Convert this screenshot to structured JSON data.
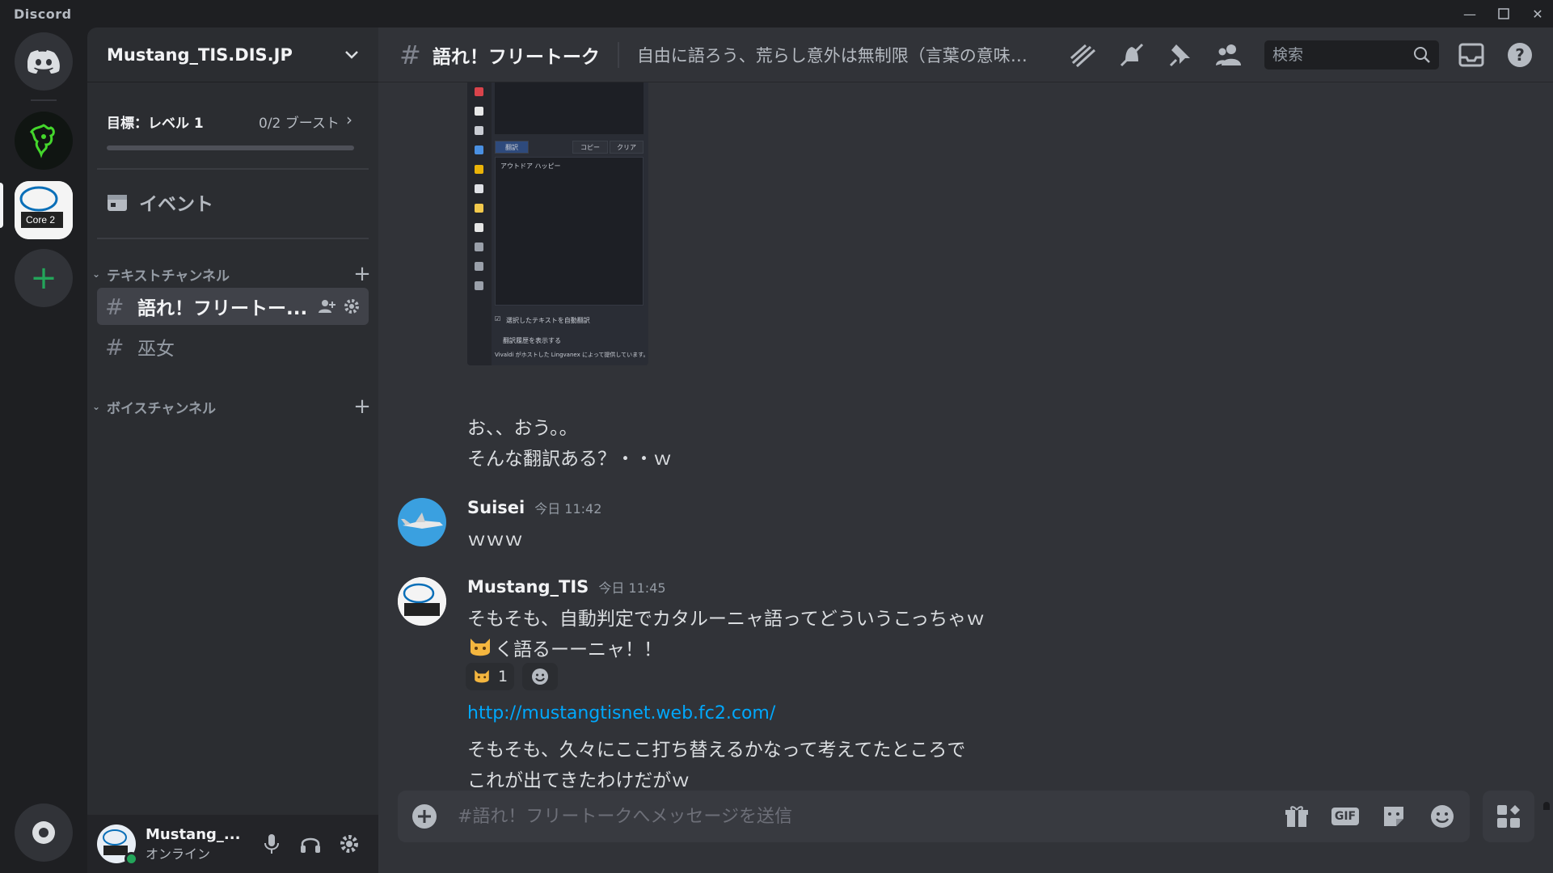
{
  "app": {
    "title": "Discord"
  },
  "server": {
    "name": "Mustang_TIS.DIS.JP",
    "boost_goal": "目標：レベル 1",
    "boost_count": "0/2 ブースト",
    "boost_progress": 0,
    "events_label": "イベント"
  },
  "categories": {
    "text": {
      "label": "テキストチャンネル"
    },
    "voice": {
      "label": "ボイスチャンネル"
    }
  },
  "channels": [
    {
      "name": "語れ！フリートー...",
      "active": true
    },
    {
      "name": "巫女",
      "active": false
    }
  ],
  "user": {
    "name": "Mustang_...",
    "status": "オンライン"
  },
  "header": {
    "channel_name": "語れ！フリートーク",
    "topic": "自由に語ろう、荒らし意外は無制限（言葉の意味を...",
    "search_placeholder": "検索"
  },
  "screenshot": {
    "tab_translate": "翻訳",
    "tab_copy": "コピー",
    "tab_clear": "クリア",
    "output_text": "アウトドア ハッピー",
    "checkbox_label": "選択したテキストを自動翻訳",
    "history_button": "翻訳履歴を表示する",
    "footer": "Vivaldi がホストした Lingvanex によって提供しています。"
  },
  "messages": [
    {
      "lines": [
        "お、、おう。。",
        "そんな翻訳ある？・・ｗ"
      ]
    },
    {
      "author": "Suisei",
      "time": "今日 11:42",
      "lines": [
        "ｗｗｗ"
      ]
    },
    {
      "author": "Mustang_TIS",
      "time": "今日 11:45",
      "lines": [
        "そもそも、自動判定でカタルーニャ語ってどういうこっちゃｗ",
        "くく語るーーニャ！！"
      ],
      "cat_line": "く語るーーニャ！！",
      "reaction_count": "1",
      "link": "http://mustangtisnet.web.fc2.com/",
      "after_link": [
        "そもそも、久々にここ打ち替えるかなって考えてたところで",
        "これが出てきたわけだがｗ"
      ]
    }
  ],
  "composer": {
    "placeholder": "#語れ！フリートークへメッセージを送信",
    "gif_label": "GIF"
  },
  "colors": {
    "accent_green": "#23a55a",
    "link": "#00a8fc",
    "background": "#313338"
  }
}
